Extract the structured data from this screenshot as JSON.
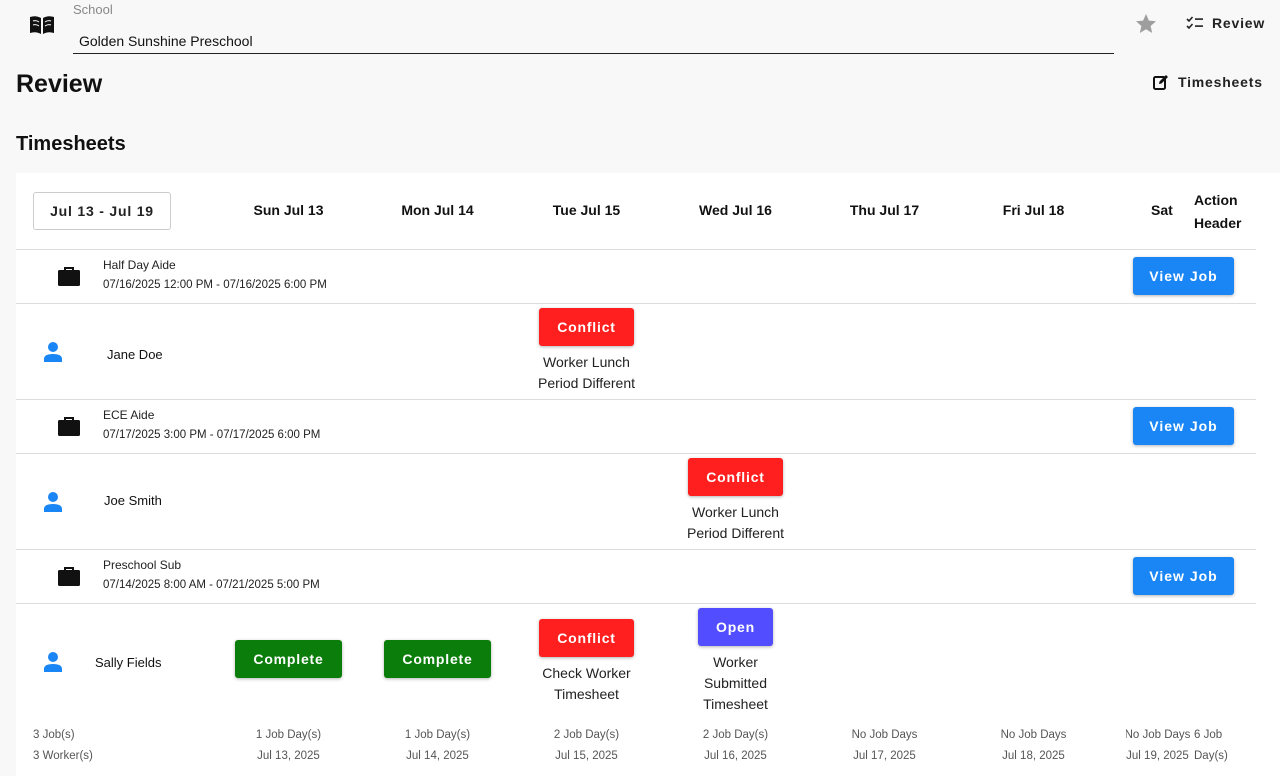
{
  "header": {
    "school_label": "School",
    "school_value": "Golden Sunshine Preschool",
    "review_label": "Review",
    "icons": [
      "book-icon",
      "star-icon",
      "checklist-icon",
      "edit-icon"
    ]
  },
  "page": {
    "title": "Review",
    "timesheets_link": "Timesheets",
    "section_title": "Timesheets"
  },
  "table": {
    "week_range": "Jul 13 - Jul 19",
    "days": [
      "Sun Jul 13",
      "Mon Jul 14",
      "Tue Jul 15",
      "Wed Jul 16",
      "Thu Jul 17",
      "Fri Jul 18",
      "Sat"
    ],
    "action_header": "Action Header",
    "view_job_label": "View Job",
    "jobs": [
      {
        "title": "Half Day Aide",
        "time": "07/16/2025 12:00 PM - 07/16/2025 6:00 PM",
        "worker": "Jane Doe",
        "statuses": [
          {
            "day": 2,
            "label": "Conflict",
            "kind": "conflict",
            "note": "Worker Lunch Period Different"
          }
        ]
      },
      {
        "title": "ECE Aide",
        "time": "07/17/2025 3:00 PM - 07/17/2025 6:00 PM",
        "worker": "Joe Smith",
        "statuses": [
          {
            "day": 3,
            "label": "Conflict",
            "kind": "conflict",
            "note": "Worker Lunch Period Different"
          }
        ]
      },
      {
        "title": "Preschool Sub",
        "time": "07/14/2025 8:00 AM - 07/21/2025 5:00 PM",
        "worker": "Sally Fields",
        "statuses": [
          {
            "day": 0,
            "label": "Complete",
            "kind": "complete",
            "note": ""
          },
          {
            "day": 1,
            "label": "Complete",
            "kind": "complete",
            "note": ""
          },
          {
            "day": 2,
            "label": "Conflict",
            "kind": "conflict",
            "note": "Check Worker Timesheet"
          },
          {
            "day": 3,
            "label": "Open",
            "kind": "open",
            "note": "Worker Submitted Timesheet"
          }
        ]
      }
    ],
    "footer": {
      "jobs_count": "3 Job(s)",
      "workers_count": "3 Worker(s)",
      "days": [
        {
          "count": "1 Job Day(s)",
          "date": "Jul 13, 2025"
        },
        {
          "count": "1 Job Day(s)",
          "date": "Jul 14, 2025"
        },
        {
          "count": "2 Job Day(s)",
          "date": "Jul 15, 2025"
        },
        {
          "count": "2 Job Day(s)",
          "date": "Jul 16, 2025"
        },
        {
          "count": "No Job Days",
          "date": "Jul 17, 2025"
        },
        {
          "count": "No Job Days",
          "date": "Jul 18, 2025"
        },
        {
          "count": "No Job Days",
          "date": "Jul 19, 2025"
        }
      ],
      "total": "6 Job Day(s)"
    }
  },
  "colors": {
    "conflict": "#ff1f1f",
    "complete": "#0b7d0b",
    "open": "#524dff",
    "primary": "#1a86f5",
    "person_icon": "#1a86f5"
  }
}
